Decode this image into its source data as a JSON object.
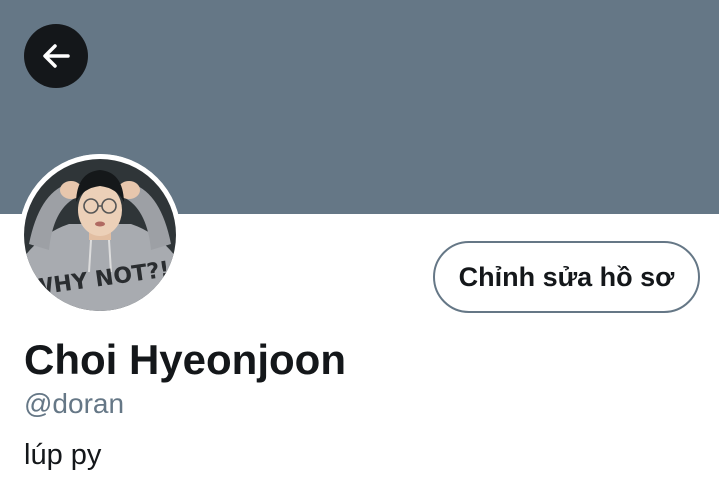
{
  "header": {
    "back_icon": "arrow-left-icon",
    "banner_color": "#657786"
  },
  "profile": {
    "avatar": "profile-photo",
    "edit_button_label": "Chỉnh sửa hồ sơ",
    "display_name": "Choi Hyeonjoon",
    "handle": "@doran",
    "bio": "lúp py"
  },
  "colors": {
    "text_primary": "#14171a",
    "text_secondary": "#657786",
    "border": "#657786"
  }
}
